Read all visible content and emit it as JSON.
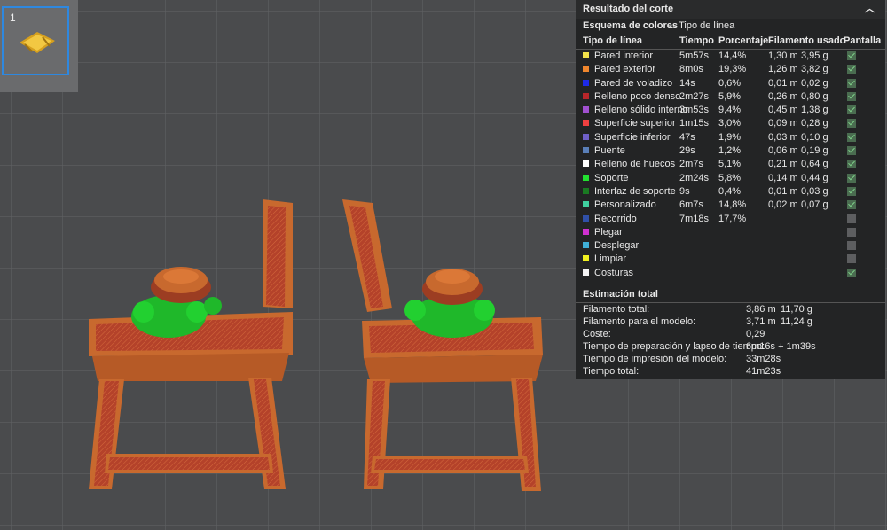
{
  "plate": {
    "number": "1"
  },
  "panel": {
    "title": "Resultado del corte",
    "collapse_icon": "chevron-up-icon",
    "scheme_label": "Esquema de colores",
    "scheme_value": "Tipo de línea",
    "columns": [
      "Tipo de línea",
      "Tiempo",
      "Porcentaje",
      "Filamento usado",
      "Pantalla"
    ],
    "rows": [
      {
        "name": "Pared interior",
        "color": "#f2e14a",
        "time": "5m57s",
        "pct": "14,4%",
        "len": "1,30 m",
        "weight": "3,95 g",
        "shown": true
      },
      {
        "name": "Pared exterior",
        "color": "#f0862d",
        "time": "8m0s",
        "pct": "19,3%",
        "len": "1,26 m",
        "weight": "3,82 g",
        "shown": true
      },
      {
        "name": "Pared de voladizo",
        "color": "#1e2ae8",
        "time": "14s",
        "pct": "0,6%",
        "len": "0,01 m",
        "weight": "0,02 g",
        "shown": true
      },
      {
        "name": "Relleno poco denso",
        "color": "#b8262a",
        "time": "2m27s",
        "pct": "5,9%",
        "len": "0,26 m",
        "weight": "0,80 g",
        "shown": true
      },
      {
        "name": "Relleno sólido interno",
        "color": "#a050d0",
        "time": "3m53s",
        "pct": "9,4%",
        "len": "0,45 m",
        "weight": "1,38 g",
        "shown": true
      },
      {
        "name": "Superficie superior",
        "color": "#f04040",
        "time": "1m15s",
        "pct": "3,0%",
        "len": "0,09 m",
        "weight": "0,28 g",
        "shown": true
      },
      {
        "name": "Superficie inferior",
        "color": "#7060c8",
        "time": "47s",
        "pct": "1,9%",
        "len": "0,03 m",
        "weight": "0,10 g",
        "shown": true
      },
      {
        "name": "Puente",
        "color": "#5a7fb8",
        "time": "29s",
        "pct": "1,2%",
        "len": "0,06 m",
        "weight": "0,19 g",
        "shown": true
      },
      {
        "name": "Relleno de huecos",
        "color": "#ffffff",
        "time": "2m7s",
        "pct": "5,1%",
        "len": "0,21 m",
        "weight": "0,64 g",
        "shown": true
      },
      {
        "name": "Soporte",
        "color": "#22e030",
        "time": "2m24s",
        "pct": "5,8%",
        "len": "0,14 m",
        "weight": "0,44 g",
        "shown": true
      },
      {
        "name": "Interfaz de soporte",
        "color": "#1a7a22",
        "time": "9s",
        "pct": "0,4%",
        "len": "0,01 m",
        "weight": "0,03 g",
        "shown": true
      },
      {
        "name": "Personalizado",
        "color": "#40d0a0",
        "time": "6m7s",
        "pct": "14,8%",
        "len": "0,02 m",
        "weight": "0,07 g",
        "shown": true
      },
      {
        "name": "Recorrido",
        "color": "#3050a8",
        "time": "7m18s",
        "pct": "17,7%",
        "len": "",
        "weight": "",
        "shown": false
      },
      {
        "name": "Plegar",
        "color": "#d030d0",
        "time": "",
        "pct": "",
        "len": "",
        "weight": "",
        "shown": false
      },
      {
        "name": "Desplegar",
        "color": "#40b0d8",
        "time": "",
        "pct": "",
        "len": "",
        "weight": "",
        "shown": false
      },
      {
        "name": "Limpiar",
        "color": "#f0f020",
        "time": "",
        "pct": "",
        "len": "",
        "weight": "",
        "shown": false
      },
      {
        "name": "Costuras",
        "color": "#f4f4f4",
        "time": "",
        "pct": "",
        "len": "",
        "weight": "",
        "shown": true
      }
    ],
    "estimate": {
      "title": "Estimación total",
      "rows": [
        {
          "k": "Filamento total:",
          "v": "3,86 m",
          "v2": "11,70 g"
        },
        {
          "k": "Filamento para el modelo:",
          "v": "3,71 m",
          "v2": "11,24 g"
        },
        {
          "k": "Coste:",
          "v": "0,29",
          "v2": ""
        },
        {
          "k": "Tiempo de preparación y lapso de tiempo:",
          "v": "6m16s + 1m39s",
          "v2": ""
        },
        {
          "k": "Tiempo de impresión del modelo:",
          "v": "33m28s",
          "v2": ""
        },
        {
          "k": "Tiempo total:",
          "v": "41m23s",
          "v2": ""
        }
      ]
    }
  }
}
